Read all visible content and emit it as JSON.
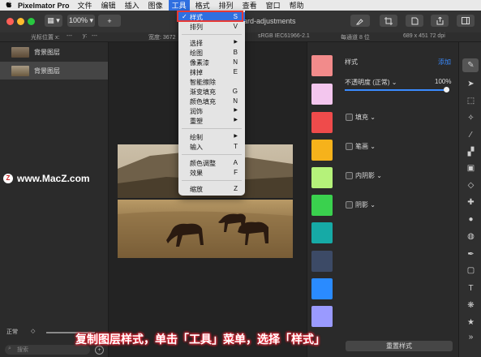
{
  "menubar": {
    "apple": "",
    "app_name": "Pixelmator Pro",
    "items": [
      "文件",
      "编辑",
      "插入",
      "图像",
      "工具",
      "格式",
      "排列",
      "查看",
      "窗口",
      "帮助"
    ],
    "active_index": 4
  },
  "toolbar": {
    "view_button": "▦ ▾",
    "zoom": "100% ▾",
    "add": "+",
    "doc_title": "ard-adjustments"
  },
  "infobar": {
    "cursor_label": "光标位置 x:",
    "cursor_x": "---",
    "cursor_y_label": "y:",
    "cursor_y": "---",
    "width_label": "宽度: 3672",
    "color_space": "sRGB IEC61966-2.1",
    "channel": "每通道 8 位",
    "size": "689 x 451 72 dpi"
  },
  "layers": [
    {
      "name": "背景图层"
    },
    {
      "name": "背景图层"
    }
  ],
  "blend": {
    "mode": "正常",
    "arrows": "◇"
  },
  "search": {
    "placeholder": "搜索"
  },
  "styles_panel": {
    "title": "样式",
    "add": "添加",
    "opacity_label": "不透明度 (正常) ⌄",
    "opacity_value": "100%",
    "opacity": 1.0,
    "fill": "填充 ⌄",
    "stroke": "笔画 ⌄",
    "inner_shadow": "内阴影 ⌄",
    "shadow": "阴影 ⌄",
    "reset": "重置样式"
  },
  "presets": [
    "#f28b8b",
    "#f3c6ee",
    "#ef4b4b",
    "#f6b21b",
    "#b5f27a",
    "#3ad14e",
    "#16aaa6",
    "#3c4a66",
    "#2a8bff",
    "#9a9aff"
  ],
  "menu": {
    "items": [
      {
        "label": "样式",
        "shortcut": "S",
        "checked": true,
        "highlight": true
      },
      {
        "label": "排列",
        "shortcut": "V",
        "checked": false
      },
      {
        "label": "选择",
        "shortcut": "▶"
      },
      {
        "label": "绘图",
        "shortcut": "B"
      },
      {
        "label": "像素漆",
        "shortcut": "N"
      },
      {
        "label": "抹掉",
        "shortcut": "E"
      },
      {
        "label": "智能擦除",
        "shortcut": ""
      },
      {
        "label": "渐变填充",
        "shortcut": "G"
      },
      {
        "label": "颜色填充",
        "shortcut": "N"
      },
      {
        "label": "润饰",
        "shortcut": "▶"
      },
      {
        "label": "重塑",
        "shortcut": "▶"
      },
      {
        "label": "绘制",
        "shortcut": "▶"
      },
      {
        "label": "输入",
        "shortcut": "T"
      },
      {
        "label": "颜色调整",
        "shortcut": "A"
      },
      {
        "label": "效果",
        "shortcut": "F"
      },
      {
        "label": "缩放",
        "shortcut": "Z"
      }
    ]
  },
  "watermark": {
    "logo": "Z",
    "text": "www.MacZ.com"
  },
  "caption": "复制图层样式，单击「工具」菜单，选择「样式」",
  "tools": [
    "brush-icon",
    "arrow-icon",
    "select-icon",
    "wand-icon",
    "pen-icon",
    "gradient-icon",
    "eraser-icon",
    "bandage-icon",
    "drop-icon",
    "paint-icon",
    "pen-nib-icon",
    "shape-icon",
    "text-icon",
    "effects-icon",
    "star-icon",
    "more-icon"
  ]
}
